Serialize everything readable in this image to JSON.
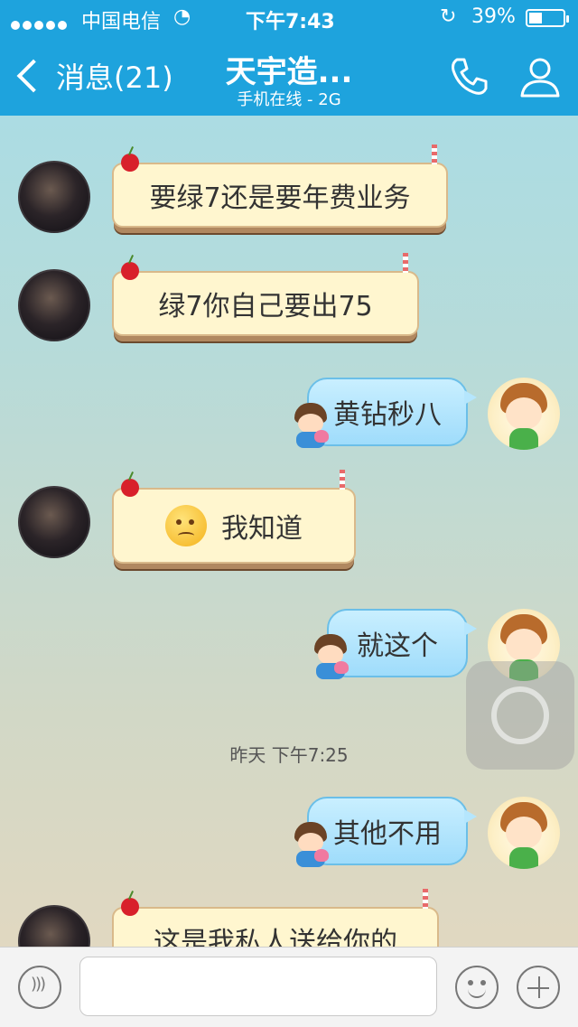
{
  "status_bar": {
    "carrier": "中国电信",
    "time": "下午7:43",
    "battery_percent_label": "39%",
    "battery_level": 0.39
  },
  "nav": {
    "back_label": "消息(21)",
    "title": "天宇造...",
    "subtitle": "手机在线 - 2G"
  },
  "messages": [
    {
      "sender": "other",
      "text": "要绿7还是要年费业务"
    },
    {
      "sender": "other",
      "text": "绿7你自己要出75"
    },
    {
      "sender": "me",
      "text": "黄钻秒八"
    },
    {
      "sender": "other",
      "text": "我知道",
      "emoji": "worried-face"
    },
    {
      "sender": "me",
      "text": "就这个"
    },
    {
      "sender": "me",
      "text": "其他不用"
    },
    {
      "sender": "other",
      "text": "这是我私人送给你的"
    }
  ],
  "timestamp": "昨天 下午7:25",
  "input": {
    "value": "",
    "placeholder": ""
  },
  "colors": {
    "nav_bar": "#1ea3dd",
    "my_bubble": "#b5e6fd",
    "other_bubble": "#fff6cf"
  }
}
